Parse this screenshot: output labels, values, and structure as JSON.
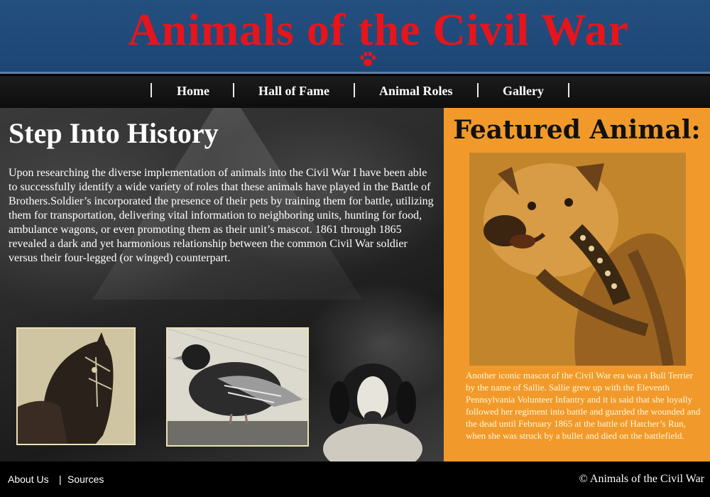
{
  "header": {
    "title": "Animals of the Civil War",
    "paw_icon": "paw-icon",
    "title_color": "#e8141c",
    "background_color": "#1f4a79"
  },
  "nav": {
    "items": [
      {
        "label": "Home"
      },
      {
        "label": "Hall of Fame"
      },
      {
        "label": "Animal Roles"
      },
      {
        "label": "Gallery"
      }
    ]
  },
  "main": {
    "heading": "Step Into History",
    "intro": "Upon researching the diverse implementation of animals into the Civil War I have been able to successfully identify a wide variety of roles that these animals have played in the Battle of Brothers.Soldier’s incorporated the presence of their pets by training them for battle, utilizing them for transportation, delivering vital information to neighboring units, hunting for food, ambulance wagons, or even promoting them as their unit’s mascot.  1861 through 1865 revealed a dark and yet harmonious relationship between the common Civil War soldier versus their four-legged (or winged) counterpart.",
    "photos": [
      "horse-photo",
      "pigeon-photo",
      "dog-photo"
    ]
  },
  "featured": {
    "heading": "Featured Animal:",
    "photo": "bull-terrier-photo",
    "text": "Another iconic mascot of the Civil War era was a Bull Terrier by the name of Sallie. Sallie grew up with the Eleventh Pennsylvania Volunteer Infantry and it is said that she loyally followed her regiment into battle and guarded the wounded and the dead until February 1865 at the battle of Hatcher’s Run, when she was struck by a bullet and died on the battlefield.",
    "background_color": "#f19a2b"
  },
  "footer": {
    "about_label": "About Us",
    "separator": "|",
    "sources_label": "Sources",
    "copyright": "© Animals of the Civil War"
  }
}
